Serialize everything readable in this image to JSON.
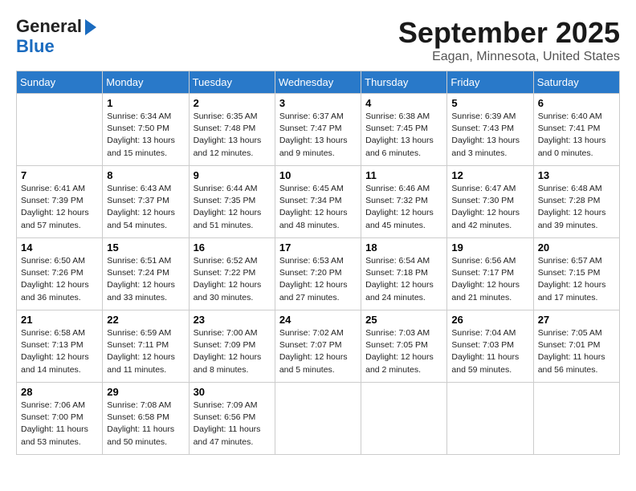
{
  "logo": {
    "line1": "General",
    "line2": "Blue",
    "arrow": true
  },
  "header": {
    "month": "September 2025",
    "location": "Eagan, Minnesota, United States"
  },
  "weekdays": [
    "Sunday",
    "Monday",
    "Tuesday",
    "Wednesday",
    "Thursday",
    "Friday",
    "Saturday"
  ],
  "weeks": [
    [
      {
        "day": "",
        "info": ""
      },
      {
        "day": "1",
        "info": "Sunrise: 6:34 AM\nSunset: 7:50 PM\nDaylight: 13 hours\nand 15 minutes."
      },
      {
        "day": "2",
        "info": "Sunrise: 6:35 AM\nSunset: 7:48 PM\nDaylight: 13 hours\nand 12 minutes."
      },
      {
        "day": "3",
        "info": "Sunrise: 6:37 AM\nSunset: 7:47 PM\nDaylight: 13 hours\nand 9 minutes."
      },
      {
        "day": "4",
        "info": "Sunrise: 6:38 AM\nSunset: 7:45 PM\nDaylight: 13 hours\nand 6 minutes."
      },
      {
        "day": "5",
        "info": "Sunrise: 6:39 AM\nSunset: 7:43 PM\nDaylight: 13 hours\nand 3 minutes."
      },
      {
        "day": "6",
        "info": "Sunrise: 6:40 AM\nSunset: 7:41 PM\nDaylight: 13 hours\nand 0 minutes."
      }
    ],
    [
      {
        "day": "7",
        "info": "Sunrise: 6:41 AM\nSunset: 7:39 PM\nDaylight: 12 hours\nand 57 minutes."
      },
      {
        "day": "8",
        "info": "Sunrise: 6:43 AM\nSunset: 7:37 PM\nDaylight: 12 hours\nand 54 minutes."
      },
      {
        "day": "9",
        "info": "Sunrise: 6:44 AM\nSunset: 7:35 PM\nDaylight: 12 hours\nand 51 minutes."
      },
      {
        "day": "10",
        "info": "Sunrise: 6:45 AM\nSunset: 7:34 PM\nDaylight: 12 hours\nand 48 minutes."
      },
      {
        "day": "11",
        "info": "Sunrise: 6:46 AM\nSunset: 7:32 PM\nDaylight: 12 hours\nand 45 minutes."
      },
      {
        "day": "12",
        "info": "Sunrise: 6:47 AM\nSunset: 7:30 PM\nDaylight: 12 hours\nand 42 minutes."
      },
      {
        "day": "13",
        "info": "Sunrise: 6:48 AM\nSunset: 7:28 PM\nDaylight: 12 hours\nand 39 minutes."
      }
    ],
    [
      {
        "day": "14",
        "info": "Sunrise: 6:50 AM\nSunset: 7:26 PM\nDaylight: 12 hours\nand 36 minutes."
      },
      {
        "day": "15",
        "info": "Sunrise: 6:51 AM\nSunset: 7:24 PM\nDaylight: 12 hours\nand 33 minutes."
      },
      {
        "day": "16",
        "info": "Sunrise: 6:52 AM\nSunset: 7:22 PM\nDaylight: 12 hours\nand 30 minutes."
      },
      {
        "day": "17",
        "info": "Sunrise: 6:53 AM\nSunset: 7:20 PM\nDaylight: 12 hours\nand 27 minutes."
      },
      {
        "day": "18",
        "info": "Sunrise: 6:54 AM\nSunset: 7:18 PM\nDaylight: 12 hours\nand 24 minutes."
      },
      {
        "day": "19",
        "info": "Sunrise: 6:56 AM\nSunset: 7:17 PM\nDaylight: 12 hours\nand 21 minutes."
      },
      {
        "day": "20",
        "info": "Sunrise: 6:57 AM\nSunset: 7:15 PM\nDaylight: 12 hours\nand 17 minutes."
      }
    ],
    [
      {
        "day": "21",
        "info": "Sunrise: 6:58 AM\nSunset: 7:13 PM\nDaylight: 12 hours\nand 14 minutes."
      },
      {
        "day": "22",
        "info": "Sunrise: 6:59 AM\nSunset: 7:11 PM\nDaylight: 12 hours\nand 11 minutes."
      },
      {
        "day": "23",
        "info": "Sunrise: 7:00 AM\nSunset: 7:09 PM\nDaylight: 12 hours\nand 8 minutes."
      },
      {
        "day": "24",
        "info": "Sunrise: 7:02 AM\nSunset: 7:07 PM\nDaylight: 12 hours\nand 5 minutes."
      },
      {
        "day": "25",
        "info": "Sunrise: 7:03 AM\nSunset: 7:05 PM\nDaylight: 12 hours\nand 2 minutes."
      },
      {
        "day": "26",
        "info": "Sunrise: 7:04 AM\nSunset: 7:03 PM\nDaylight: 11 hours\nand 59 minutes."
      },
      {
        "day": "27",
        "info": "Sunrise: 7:05 AM\nSunset: 7:01 PM\nDaylight: 11 hours\nand 56 minutes."
      }
    ],
    [
      {
        "day": "28",
        "info": "Sunrise: 7:06 AM\nSunset: 7:00 PM\nDaylight: 11 hours\nand 53 minutes."
      },
      {
        "day": "29",
        "info": "Sunrise: 7:08 AM\nSunset: 6:58 PM\nDaylight: 11 hours\nand 50 minutes."
      },
      {
        "day": "30",
        "info": "Sunrise: 7:09 AM\nSunset: 6:56 PM\nDaylight: 11 hours\nand 47 minutes."
      },
      {
        "day": "",
        "info": ""
      },
      {
        "day": "",
        "info": ""
      },
      {
        "day": "",
        "info": ""
      },
      {
        "day": "",
        "info": ""
      }
    ]
  ]
}
